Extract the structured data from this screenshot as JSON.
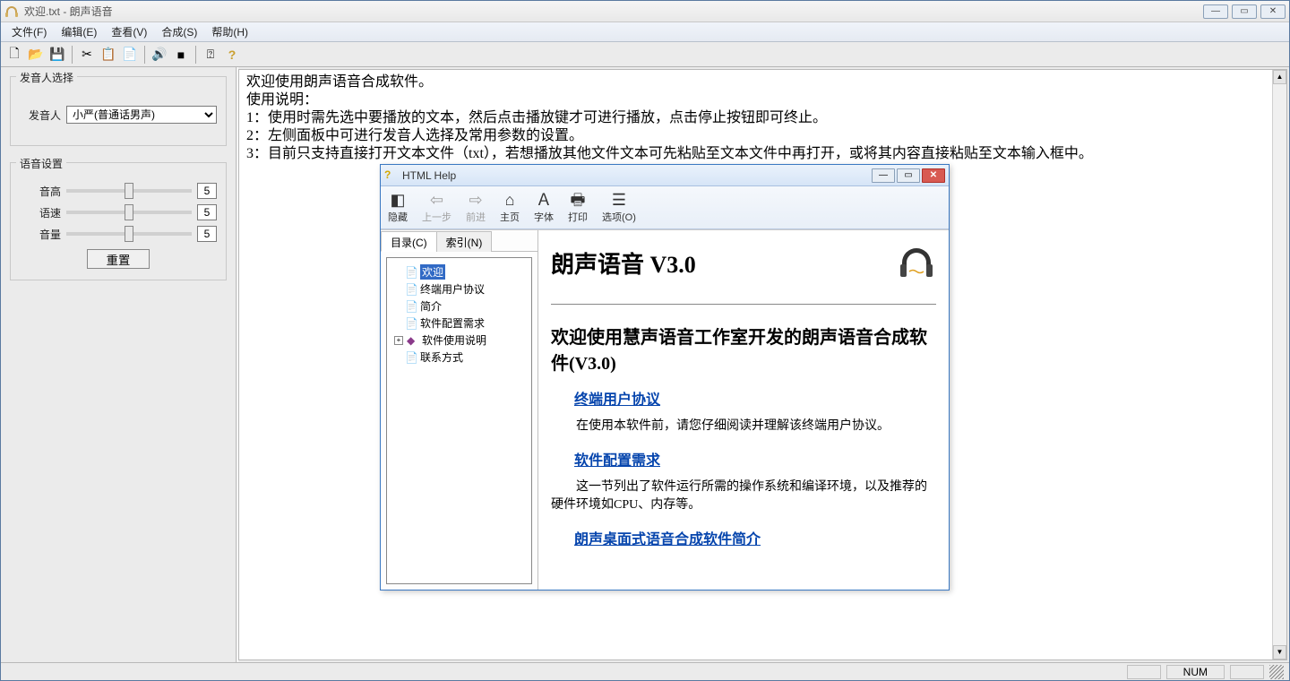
{
  "window": {
    "title": "欢迎.txt - 朗声语音"
  },
  "menu": {
    "file": "文件(F)",
    "edit": "编辑(E)",
    "view": "查看(V)",
    "synthesize": "合成(S)",
    "help": "帮助(H)"
  },
  "sidebar": {
    "voice_select_title": "发音人选择",
    "voice_label": "发音人",
    "voice_value": "小严(普通话男声)",
    "voice_settings_title": "语音设置",
    "pitch_label": "音高",
    "pitch_value": "5",
    "speed_label": "语速",
    "speed_value": "5",
    "volume_label": "音量",
    "volume_value": "5",
    "reset_label": "重置"
  },
  "editor": {
    "line1": "欢迎使用朗声语音合成软件。",
    "line2": "使用说明：",
    "line3": "1：使用时需先选中要播放的文本，然后点击播放键才可进行播放，点击停止按钮即可终止。",
    "line4": "2：左侧面板中可进行发音人选择及常用参数的设置。",
    "line5": "3：目前只支持直接打开文本文件（txt），若想播放其他文件文本可先粘贴至文本文件中再打开，或将其内容直接粘贴至文本输入框中。"
  },
  "help": {
    "title": "HTML Help",
    "tb": {
      "hide": "隐藏",
      "back": "上一步",
      "forward": "前进",
      "home": "主页",
      "font": "字体",
      "print": "打印",
      "options": "选项(O)"
    },
    "tabs": {
      "contents": "目录(C)",
      "index": "索引(N)"
    },
    "tree": {
      "welcome": "欢迎",
      "eula": "终端用户协议",
      "intro": "简介",
      "requirements": "软件配置需求",
      "usage": "软件使用说明",
      "contact": "联系方式"
    },
    "page": {
      "title": "朗声语音  V3.0",
      "h2": "欢迎使用慧声语音工作室开发的朗声语音合成软件(V3.0)",
      "link1": "终端用户协议",
      "p1": "在使用本软件前，请您仔细阅读并理解该终端用户协议。",
      "link2": "软件配置需求",
      "p2": "这一节列出了软件运行所需的操作系统和编译环境，以及推荐的硬件环境如CPU、内存等。",
      "link3": "朗声桌面式语音合成软件简介"
    }
  },
  "status": {
    "num": "NUM"
  }
}
